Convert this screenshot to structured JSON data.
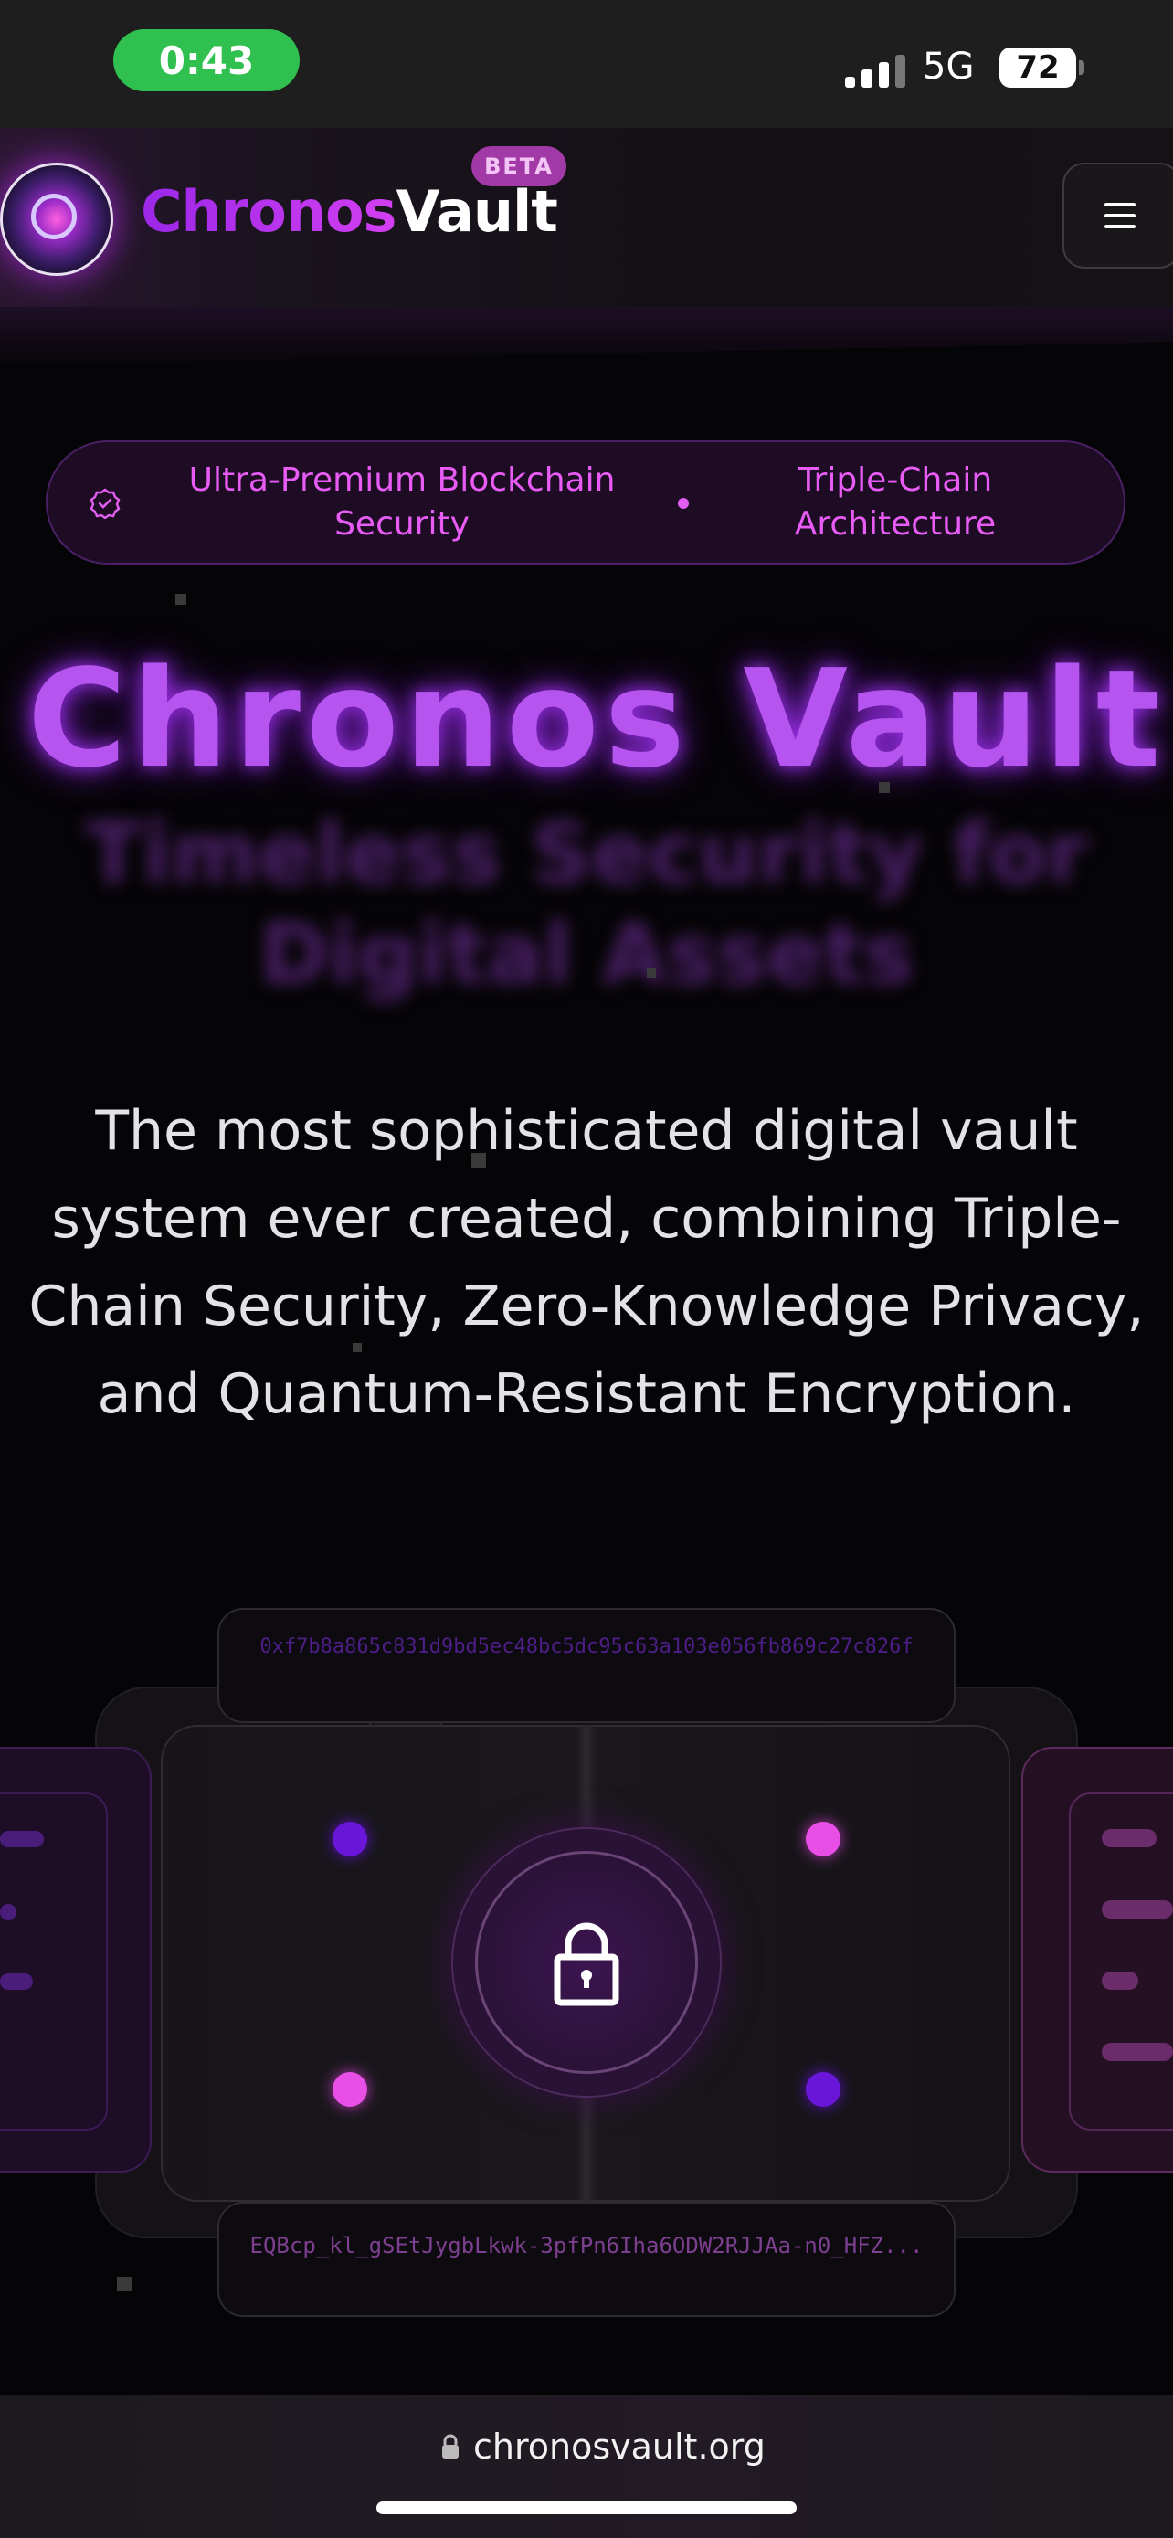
{
  "status_bar": {
    "time": "0:43",
    "network": "5G",
    "battery": "72"
  },
  "header": {
    "brand_first": "Chronos",
    "brand_second": "Vault",
    "badge": "BETA",
    "menu_icon": "hamburger-menu-icon"
  },
  "feature_pill": {
    "icon": "verified-badge-icon",
    "item1": "Ultra-Premium Blockchain Security",
    "item2": "Triple-Chain Architecture"
  },
  "hero": {
    "title": "Chronos Vault",
    "subtitle": "Timeless Security for Digital Assets",
    "description": "The most sophisticated digital vault system ever created, combining Triple-Chain Security, Zero-Knowledge Privacy, and Quantum-Resistant Encryption."
  },
  "vault_graphic": {
    "hash_top": "0xf7b8a865c831d9bd5ec48bc5dc95c63a103e056fb869c27c826f",
    "hash_bottom": "EQBcp_kl_gSEtJygbLkwk-3pfPn6Iha6ODW2RJJAa-n0_HFZ...",
    "center_icon": "padlock-icon",
    "colors": {
      "purple": "#6a16d8",
      "pink": "#e74fe6"
    }
  },
  "browser": {
    "url": "chronosvault.org",
    "lock_icon": "lock-icon"
  }
}
